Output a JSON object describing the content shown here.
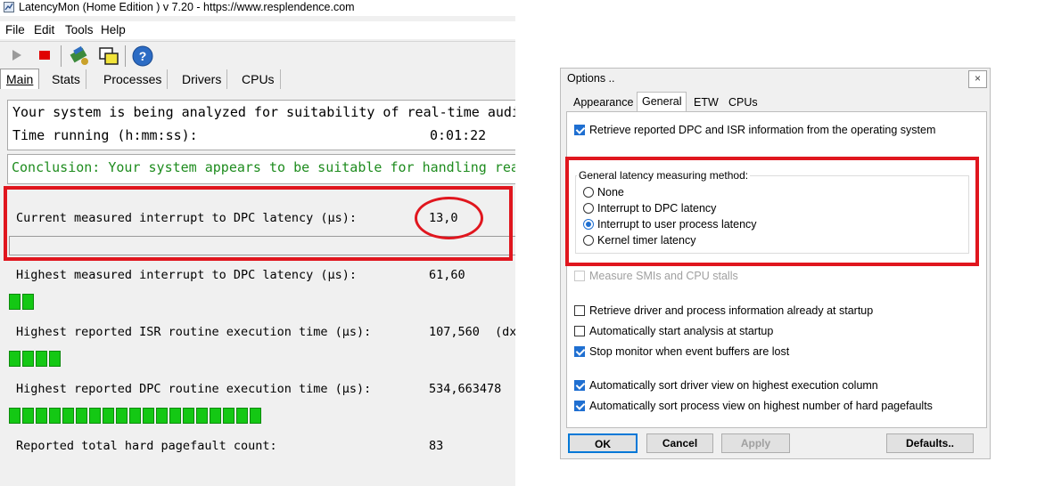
{
  "latencymon": {
    "title": "LatencyMon  (Home Edition )  v 7.20 - https://www.resplendence.com",
    "menu": [
      "File",
      "Edit",
      "Tools",
      "Help"
    ],
    "toolbar_icons": [
      "play-icon",
      "stop-icon",
      "drivers-icon",
      "windows-icon",
      "help-icon"
    ],
    "tabs": [
      "Main",
      "Stats",
      "Processes",
      "Drivers",
      "CPUs"
    ],
    "status": {
      "analyzing": "Your system is being analyzed for suitability of real-time audi",
      "time_label": "Time running (h:mm:ss):",
      "time_value": "0:01:22",
      "conclusion": "Conclusion: Your system appears to be suitable for handling rea"
    },
    "metrics": [
      {
        "label": "Current measured interrupt to DPC latency (µs):",
        "value": "13,0",
        "extra": "",
        "bar_segments": 0
      },
      {
        "label": "Highest measured interrupt to DPC latency (µs):",
        "value": "61,60",
        "extra": "",
        "bar_segments": 2
      },
      {
        "label": "Highest reported ISR routine execution time (µs):",
        "value": "107,560",
        "extra": "(dx",
        "bar_segments": 4
      },
      {
        "label": "Highest reported DPC routine execution time (µs):",
        "value": "534,663478",
        "extra": "",
        "bar_segments": 19
      },
      {
        "label": "Reported total hard pagefault count:",
        "value": "83",
        "extra": "",
        "bar_segments": 0
      }
    ],
    "colors": {
      "conclusion_text": "#1e8c1e",
      "gauge": "#14c814",
      "highlight": "#e0161e"
    }
  },
  "options": {
    "title": "Options ..",
    "close": "×",
    "tabs": [
      "Appearance",
      "General",
      "ETW",
      "CPUs"
    ],
    "selected_tab": "General",
    "retrieve_dpc": {
      "label": "Retrieve reported DPC and ISR information from the operating system",
      "checked": true
    },
    "method_group": {
      "label": "General latency measuring method:",
      "options": [
        {
          "label": "None",
          "selected": false
        },
        {
          "label": "Interrupt to DPC latency",
          "selected": false
        },
        {
          "label": "Interrupt to user process latency",
          "selected": true
        },
        {
          "label": "Kernel timer latency",
          "selected": false
        }
      ]
    },
    "measure_smi": {
      "label": "Measure SMIs and CPU stalls",
      "checked": false,
      "enabled": false
    },
    "checkboxes": [
      {
        "label": "Retrieve driver and process information already at startup",
        "checked": false
      },
      {
        "label": "Automatically start analysis at startup",
        "checked": false
      },
      {
        "label": "Stop monitor when event buffers are lost",
        "checked": true
      },
      {
        "label": "Automatically sort driver view on highest execution column",
        "checked": true
      },
      {
        "label": "Automatically sort process view on highest number of hard pagefaults",
        "checked": true
      }
    ],
    "buttons": {
      "ok": "OK",
      "cancel": "Cancel",
      "apply": "Apply",
      "defaults": "Defaults.."
    }
  }
}
